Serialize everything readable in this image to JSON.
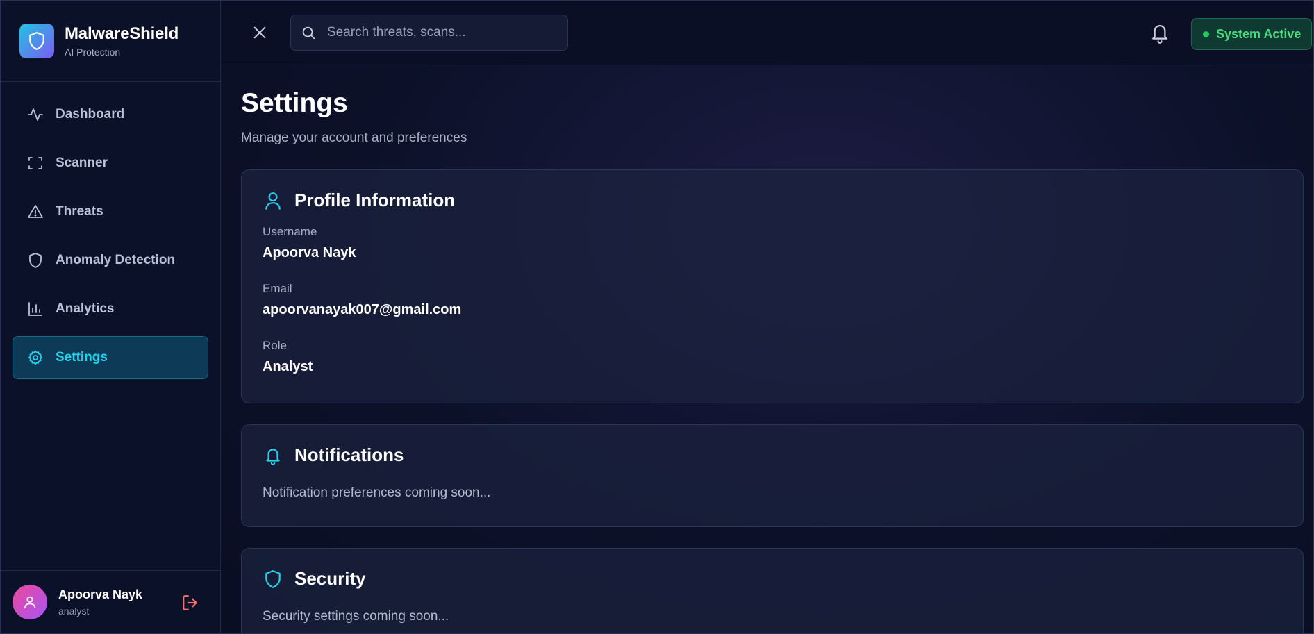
{
  "brand": {
    "name": "MalwareShield",
    "subtitle": "AI Protection"
  },
  "sidebar": {
    "items": [
      {
        "label": "Dashboard",
        "icon": "activity-icon",
        "active": false
      },
      {
        "label": "Scanner",
        "icon": "scan-icon",
        "active": false
      },
      {
        "label": "Threats",
        "icon": "warning-icon",
        "active": false
      },
      {
        "label": "Anomaly Detection",
        "icon": "shield-icon",
        "active": false
      },
      {
        "label": "Analytics",
        "icon": "bar-chart-icon",
        "active": false
      },
      {
        "label": "Settings",
        "icon": "gear-icon",
        "active": true
      }
    ]
  },
  "user": {
    "name": "Apoorva Nayk",
    "role": "analyst"
  },
  "topbar": {
    "search_placeholder": "Search threats, scans...",
    "search_value": "",
    "status_label": "System Active"
  },
  "page": {
    "title": "Settings",
    "subtitle": "Manage your account and preferences"
  },
  "profile": {
    "title": "Profile Information",
    "fields": [
      {
        "label": "Username",
        "value": "Apoorva Nayk"
      },
      {
        "label": "Email",
        "value": "apoorvanayak007@gmail.com"
      },
      {
        "label": "Role",
        "value": "Analyst"
      }
    ]
  },
  "notifications": {
    "title": "Notifications",
    "text": "Notification preferences coming soon..."
  },
  "security": {
    "title": "Security",
    "text": "Security settings coming soon..."
  },
  "colors": {
    "accent": "#22d3ee",
    "status_green": "#4ade80",
    "logout_red": "#f87171",
    "background": "#0a0e23"
  }
}
